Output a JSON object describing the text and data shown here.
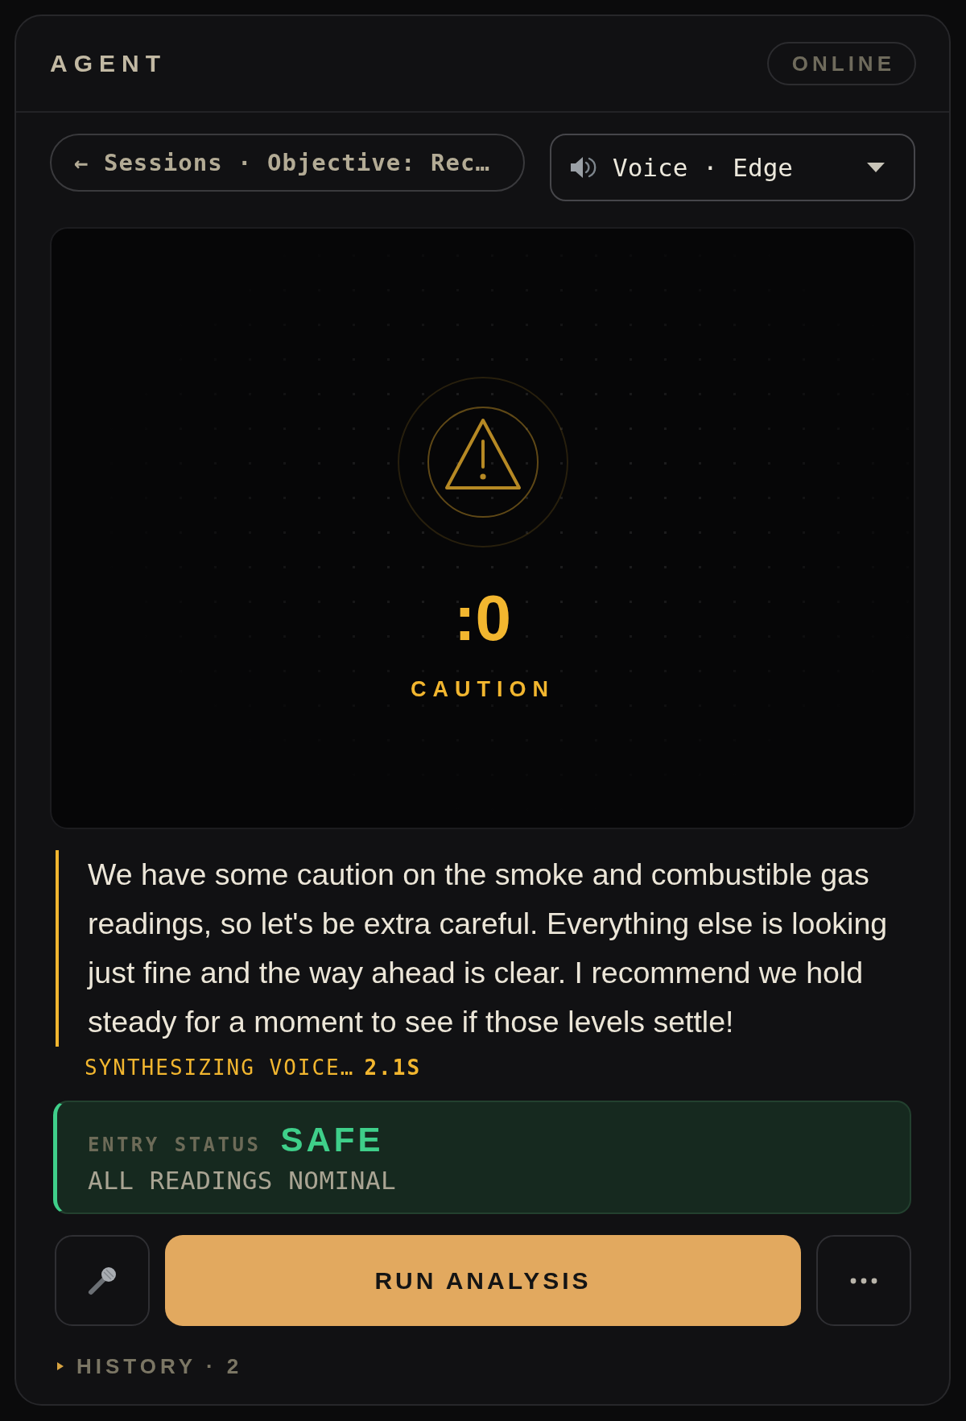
{
  "header": {
    "title": "AGENT",
    "status": "ONLINE"
  },
  "session": {
    "breadcrumb": "← Sessions · Objective: Rec…"
  },
  "voice_select": {
    "value": "Voice · Edge"
  },
  "alert": {
    "kind": "caution",
    "reading": ":0",
    "label": "CAUTION"
  },
  "message": {
    "text": "We have some caution on the smoke and combustible gas readings, so let's be extra careful. Everything else is looking just fine and the way ahead is clear. I recommend we hold steady for a moment to see if those levels settle!",
    "status": "SYNTHESIZING VOICE…",
    "elapsed": "2.1S"
  },
  "entry_status": {
    "kind": "safe",
    "label": "ENTRY STATUS",
    "value": "SAFE",
    "detail": "ALL READINGS NOMINAL"
  },
  "primary_action": "RUN ANALYSIS",
  "history": {
    "label": "HISTORY · 2",
    "expanded": false
  }
}
